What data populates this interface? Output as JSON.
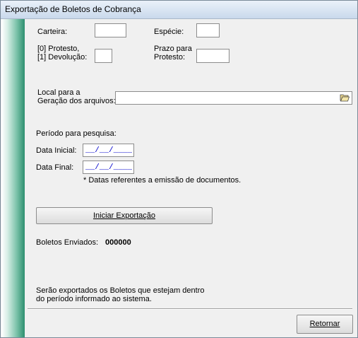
{
  "window": {
    "title": "Exportação de Boletos de Cobrança"
  },
  "form": {
    "carteira_label": "Carteira:",
    "especie_label": "Espécie:",
    "protesto_line1": "[0] Protesto,",
    "protesto_line2": "[1] Devolução:",
    "prazo_line1": "Prazo para",
    "prazo_line2": "Protesto:",
    "local_line1": "Local para a",
    "local_line2": "Geração dos arquivos:",
    "periodo_label": "Período para pesquisa:",
    "data_inicial_label": "Data Inicial:",
    "data_inicial_value": "__/__/____",
    "data_final_label": "Data Final:",
    "data_final_value": "__/__/____",
    "datas_note": "* Datas referentes a emissão de documentos.",
    "iniciar_label": "Iniciar Exportação",
    "boletos_label": "Boletos Enviados:",
    "boletos_value": "000000",
    "info_line1": "Serão exportados os Boletos que estejam dentro",
    "info_line2": "do período informado ao sistema.",
    "retornar_label": "Retornar"
  },
  "icons": {
    "folder": "folder-open-icon"
  }
}
